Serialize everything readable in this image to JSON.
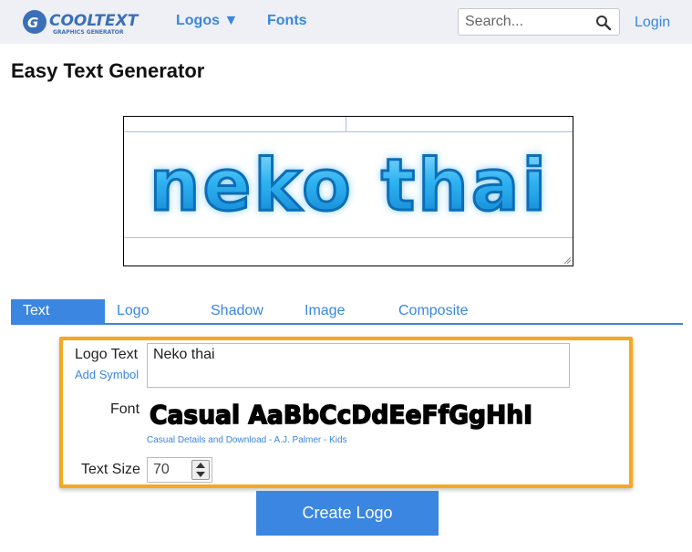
{
  "header": {
    "brand": "COOLTEXT",
    "brand_sub": "GRAPHICS GENERATOR",
    "nav": [
      {
        "label": "Logos ▼"
      },
      {
        "label": "Fonts"
      }
    ],
    "search": {
      "placeholder": "Search...",
      "value": ""
    },
    "login_label": "Login"
  },
  "page": {
    "title": "Easy Text Generator"
  },
  "preview": {
    "text": "neko thai",
    "accent": "#29a9ea"
  },
  "tabs": [
    {
      "label": "Text",
      "active": true
    },
    {
      "label": "Logo",
      "active": false
    },
    {
      "label": "Shadow",
      "active": false
    },
    {
      "label": "Image",
      "active": false
    },
    {
      "label": "Composite",
      "active": false
    }
  ],
  "form": {
    "logo_text_label": "Logo Text",
    "add_symbol_label": "Add Symbol",
    "logo_text_value": "Neko thai",
    "font_label": "Font",
    "font_sample": "Casual AaBbCcDdEeFfGgHhI",
    "font_links": {
      "details": "Casual Details and Download",
      "sep1": " - ",
      "author": "A.J. Palmer",
      "sep2": " - ",
      "category": "Kids"
    },
    "text_size_label": "Text Size",
    "text_size_value": "70",
    "create_button": "Create Logo"
  },
  "colors": {
    "accent": "#3a86e0",
    "highlight_border": "#f5a820",
    "topbar_bg": "#eef0f5"
  }
}
